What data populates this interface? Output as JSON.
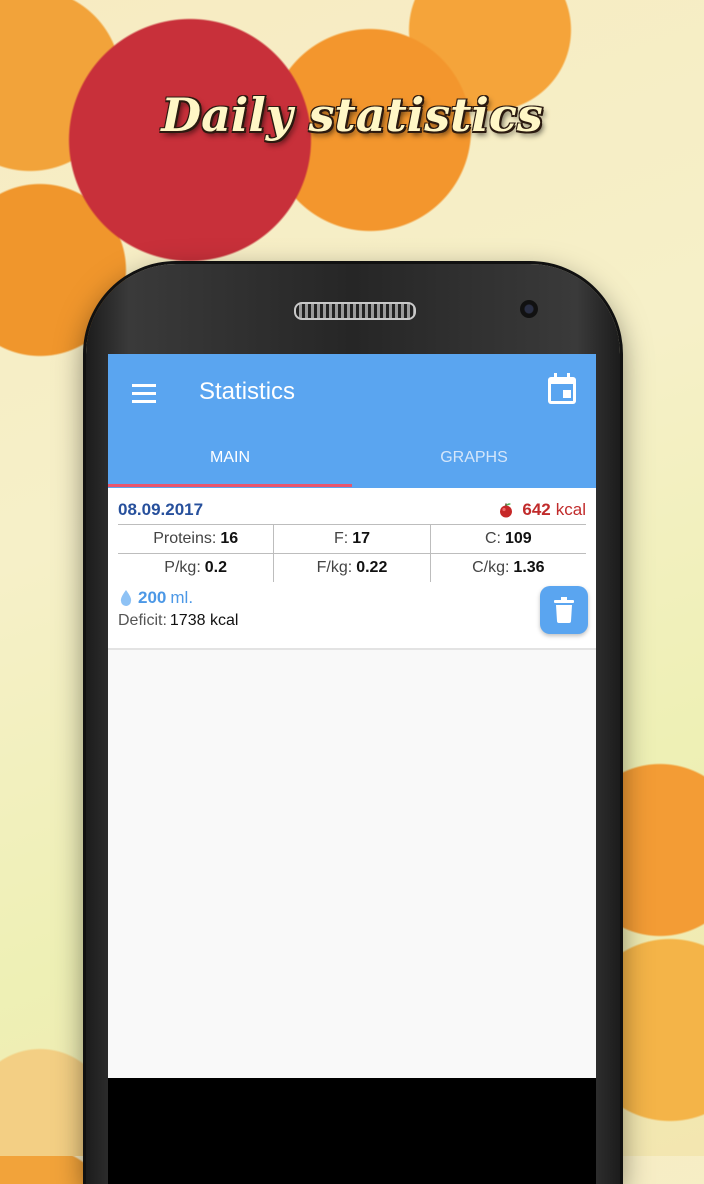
{
  "promo": {
    "headline": "Daily statistics"
  },
  "app": {
    "title": "Statistics",
    "accent": "#5aa5f0",
    "tabs": [
      {
        "label": "MAIN",
        "active": true
      },
      {
        "label": "GRAPHS",
        "active": false
      }
    ]
  },
  "entry": {
    "date": "08.09.2017",
    "kcal_value": "642",
    "kcal_unit": "kcal",
    "macros": [
      {
        "label": "Proteins:",
        "value": "16"
      },
      {
        "label": "F:",
        "value": "17"
      },
      {
        "label": "C:",
        "value": "109"
      }
    ],
    "per_kg": [
      {
        "label": "P/kg:",
        "value": "0.2"
      },
      {
        "label": "F/kg:",
        "value": "0.22"
      },
      {
        "label": "C/kg:",
        "value": "1.36"
      }
    ],
    "water_value": "200",
    "water_unit": "ml.",
    "deficit_label": "Deficit:",
    "deficit_value": "1738 kcal"
  },
  "icons": {
    "menu": "menu-icon",
    "calendar": "calendar-icon",
    "apple": "apple-icon",
    "water": "water-drop-icon",
    "trash": "trash-icon"
  }
}
